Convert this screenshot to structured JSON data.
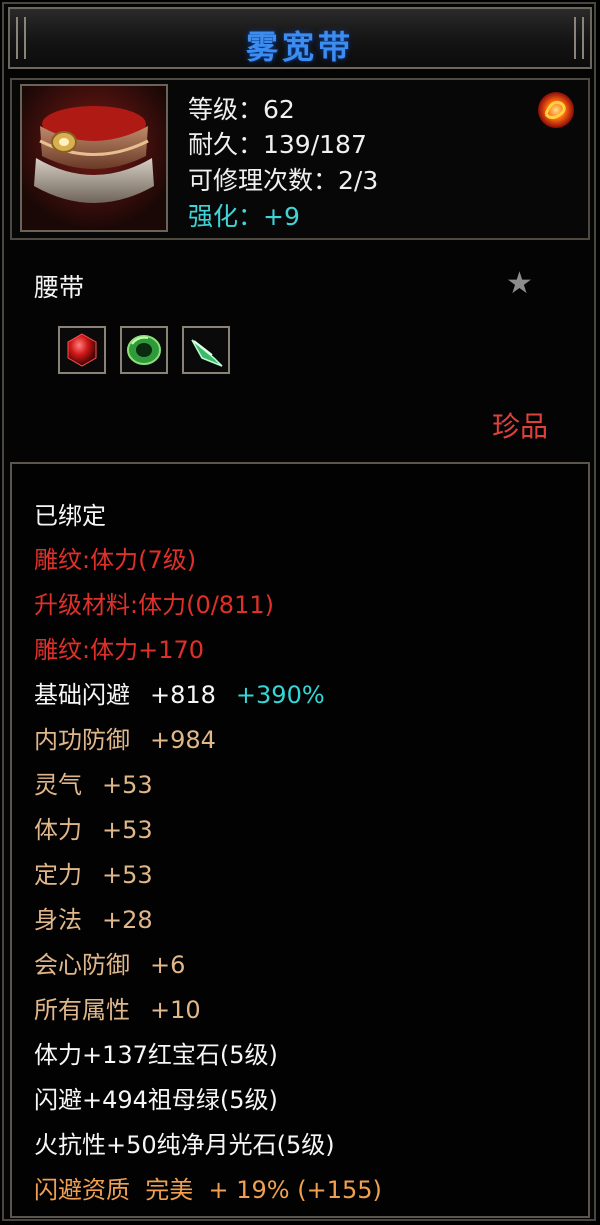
{
  "item": {
    "name": "雾宽带",
    "level": "等级：62",
    "durability": "耐久：139/187",
    "repair": "可修理次数：2/3",
    "enhance": "强化：+9",
    "type": "腰带",
    "rarity": "珍品"
  },
  "sockets": [
    {
      "icon": "ruby-gem-icon"
    },
    {
      "icon": "emerald-ring-gem-icon"
    },
    {
      "icon": "jade-gem-icon"
    }
  ],
  "attributes": {
    "bound": "已绑定",
    "engrave1": "雕纹:体力(7级)",
    "upgrade": "升级材料:体力(0/811)",
    "engrave2": "雕纹:体力+170",
    "dodge_label": "基础闪避",
    "dodge_value": "+818",
    "dodge_pct": "+390%",
    "inner_def_label": "内功防御",
    "inner_def_value": "+984",
    "spirit_label": "灵气",
    "spirit_value": "+53",
    "stamina_label": "体力",
    "stamina_value": "+53",
    "focus_label": "定力",
    "focus_value": "+53",
    "agility_label": "身法",
    "agility_value": "+28",
    "crit_def_label": "会心防御",
    "crit_def_value": "+6",
    "all_attr_label": "所有属性",
    "all_attr_value": "+10",
    "gem1": "体力+137红宝石(5级)",
    "gem2": "闪避+494祖母绿(5级)",
    "gem3": "火抗性+50纯净月光石(5级)",
    "quality": "闪避资质  完美  + 19% (+155)"
  },
  "colors": {
    "title": "#3d8cf0",
    "enhance": "#3fd4d8",
    "red": "#e0302a",
    "tan": "#e0b78a",
    "orange": "#f0a050",
    "cyan": "#34d6d6"
  }
}
